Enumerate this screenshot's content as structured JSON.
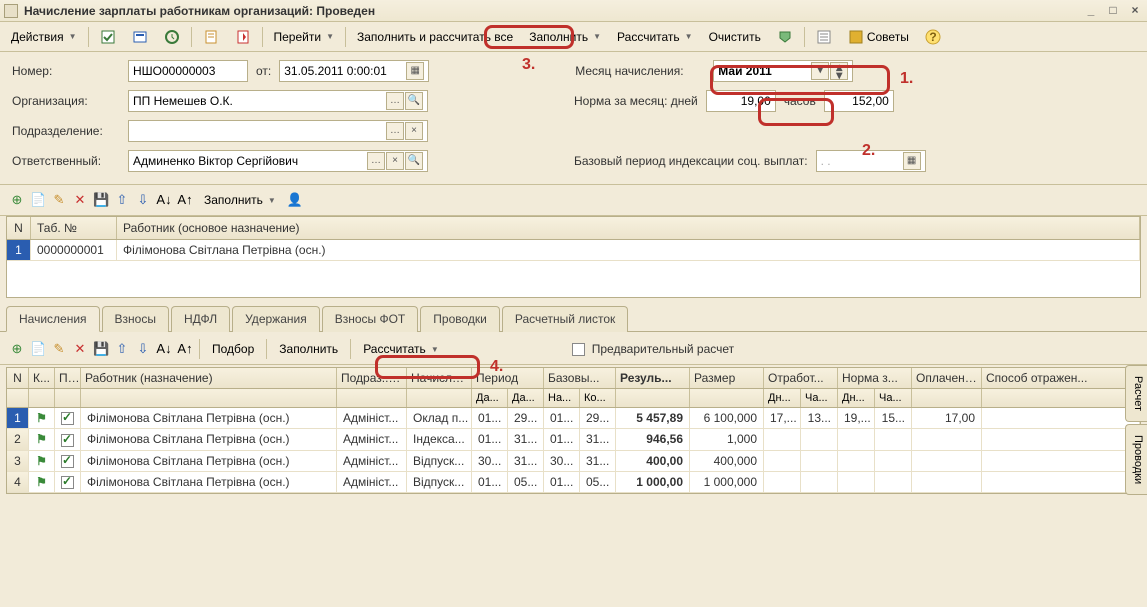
{
  "window": {
    "title": "Начисление зарплаты работникам организаций: Проведен"
  },
  "toolbar": {
    "actions": "Действия",
    "go": "Перейти",
    "fill_calc_all": "Заполнить и рассчитать все",
    "fill": "Заполнить",
    "calc": "Рассчитать",
    "clear": "Очистить",
    "tips": "Советы"
  },
  "form": {
    "number_label": "Номер:",
    "number_value": "НШО00000003",
    "from_label": "от:",
    "from_value": "31.05.2011 0:00:01",
    "month_label": "Месяц начисления:",
    "month_value": "Май 2011",
    "org_label": "Организация:",
    "org_value": "ПП Немешев О.К.",
    "norm_label": "Норма за месяц: дней",
    "norm_days": "19,00",
    "hours_label": "часов",
    "norm_hours": "152,00",
    "subdiv_label": "Подразделение:",
    "subdiv_value": "",
    "resp_label": "Ответственный:",
    "resp_value": "Админенко Віктор Сергійович",
    "base_period_label": "Базовый период индексации соц. выплат:",
    "base_period_value": ". .",
    "mini_fill": "Заполнить"
  },
  "upper_table": {
    "cols": {
      "n": "N",
      "tabno": "Таб. №",
      "worker": "Работник (основое назначение)"
    },
    "rows": [
      {
        "n": "1",
        "tabno": "0000000001",
        "worker": "Філімонова Світлана Петрівна (осн.)"
      }
    ]
  },
  "tabs": [
    "Начисления",
    "Взносы",
    "НДФЛ",
    "Удержания",
    "Взносы ФОТ",
    "Проводки",
    "Расчетный листок"
  ],
  "lower_toolbar": {
    "select": "Подбор",
    "fill": "Заполнить",
    "calc": "Рассчитать",
    "precalc": "Предварительный расчет"
  },
  "grid": {
    "cols": {
      "n": "N",
      "k": "К...",
      "p": "П...",
      "worker": "Работник (назначение)",
      "subdiv": "Подраз... организ...",
      "accr": "Начисле...",
      "period": "Период",
      "base": "Базовы...",
      "result": "Резуль...",
      "size": "Размер",
      "worked": "Отработ...",
      "norm": "Норма з...",
      "paid": "Оплачено дней/ча...",
      "method": "Способ отражен...",
      "da": "Да...",
      "na": "На...",
      "ko": "Ко...",
      "dn": "Дн...",
      "cha": "Ча..."
    },
    "rows": [
      {
        "n": "1",
        "worker": "Філімонова Світлана Петрівна (осн.)",
        "subdiv": "Адмініст...",
        "accr": "Оклад п...",
        "p_da1": "01...",
        "p_da2": "29...",
        "b_na": "01...",
        "b_ko": "29...",
        "result": "5 457,89",
        "size": "6 100,000",
        "w_dn": "17,...",
        "w_ch": "13...",
        "n_dn": "19,...",
        "n_ch": "15...",
        "paid": "17,00"
      },
      {
        "n": "2",
        "worker": "Філімонова Світлана Петрівна (осн.)",
        "subdiv": "Адмініст...",
        "accr": "Індекса...",
        "p_da1": "01...",
        "p_da2": "31...",
        "b_na": "01...",
        "b_ko": "31...",
        "result": "946,56",
        "size": "1,000",
        "w_dn": "",
        "w_ch": "",
        "n_dn": "",
        "n_ch": "",
        "paid": ""
      },
      {
        "n": "3",
        "worker": "Філімонова Світлана Петрівна (осн.)",
        "subdiv": "Адмініст...",
        "accr": "Відпуск...",
        "p_da1": "30...",
        "p_da2": "31...",
        "b_na": "30...",
        "b_ko": "31...",
        "result": "400,00",
        "size": "400,000",
        "w_dn": "",
        "w_ch": "",
        "n_dn": "",
        "n_ch": "",
        "paid": ""
      },
      {
        "n": "4",
        "worker": "Філімонова Світлана Петрівна (осн.)",
        "subdiv": "Адмініст...",
        "accr": "Відпуск...",
        "p_da1": "01...",
        "p_da2": "05...",
        "b_na": "01...",
        "b_ko": "05...",
        "result": "1 000,00",
        "size": "1 000,000",
        "w_dn": "",
        "w_ch": "",
        "n_dn": "",
        "n_ch": "",
        "paid": ""
      }
    ]
  },
  "sidetabs": [
    "Расчет",
    "Проводки"
  ],
  "annotations": {
    "l1": "1.",
    "l2": "2.",
    "l3": "3.",
    "l4": "4."
  }
}
